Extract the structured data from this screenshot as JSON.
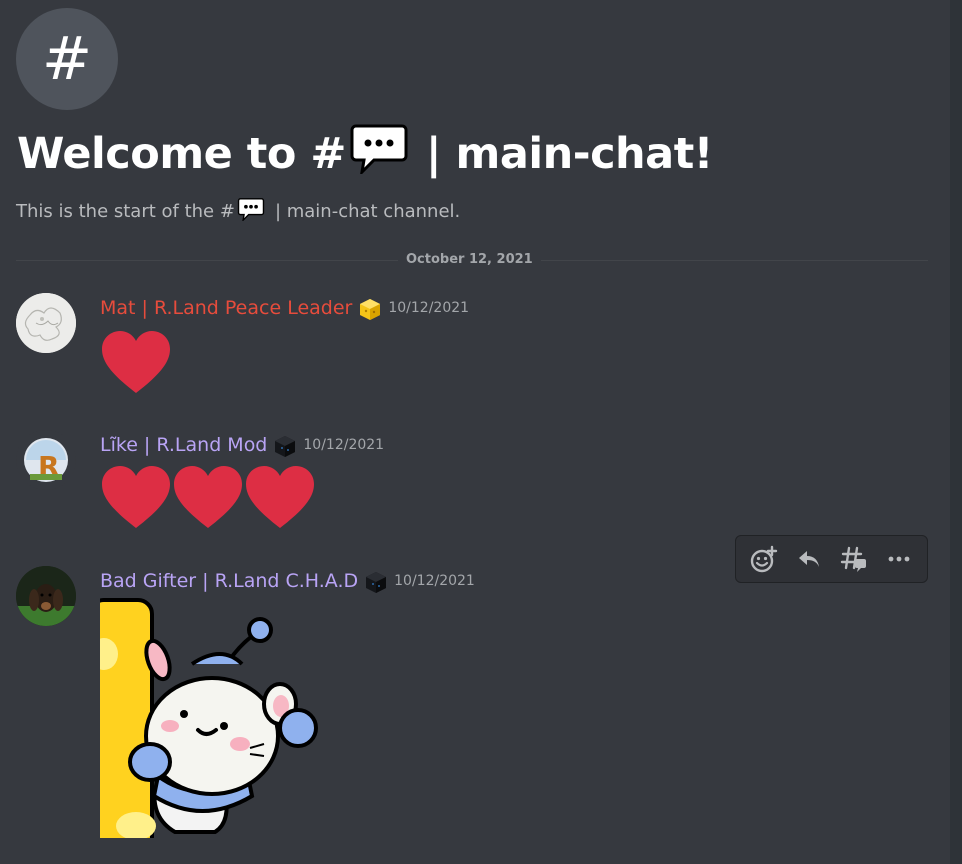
{
  "channel": {
    "icon": "hash-icon",
    "welcome_prefix": "Welcome to #",
    "welcome_suffix": "| main-chat!",
    "sub_prefix": "This is the start of the #",
    "sub_suffix": "| main-chat channel."
  },
  "divider_date": "October 12, 2021",
  "messages": [
    {
      "username": "Mat | R.Land Peace Leader",
      "name_color": "#e74c3c",
      "badge": "gold-block-badge-icon",
      "timestamp": "10/12/2021",
      "content": "heart-emoji x1"
    },
    {
      "username": "Lĩke | R.Land Mod",
      "name_color": "#b9a4f5",
      "badge": "dark-block-badge-icon",
      "timestamp": "10/12/2021",
      "content": "heart-emoji x3"
    },
    {
      "username": "Bad Gifter | R.Land C.H.A.D",
      "name_color": "#b9a4f5",
      "badge": "dark-block-badge-icon",
      "timestamp": "10/12/2021",
      "content": "mouse-peek-sticker"
    }
  ],
  "toolbar": [
    "add-reaction-icon",
    "reply-icon",
    "create-thread-icon",
    "more-options-icon"
  ],
  "colors": {
    "background": "#36393f",
    "heart": "#dd2e44",
    "mod_purple": "#b9a4f5",
    "leader_red": "#e74c3c"
  }
}
